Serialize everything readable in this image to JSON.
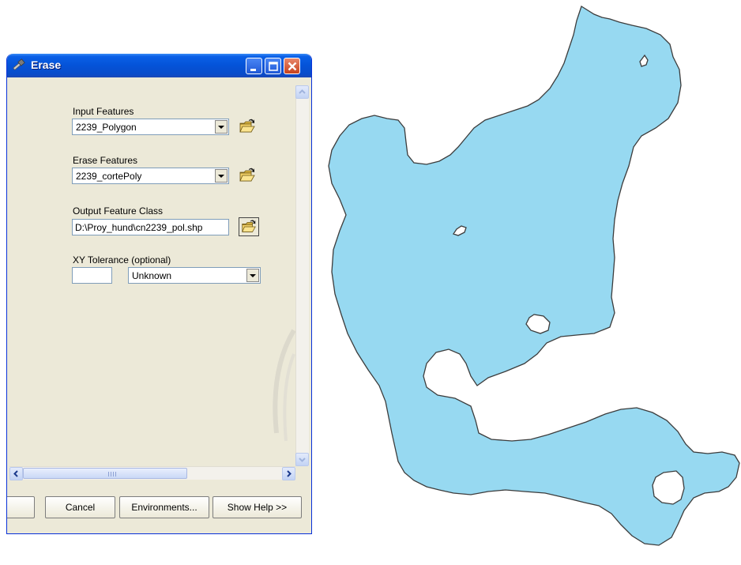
{
  "window": {
    "title": "Erase"
  },
  "form": {
    "input_features": {
      "label": "Input Features",
      "value": "2239_Polygon"
    },
    "erase_features": {
      "label": "Erase Features",
      "value": "2239_cortePoly"
    },
    "output_feature_class": {
      "label": "Output Feature Class",
      "value": "D:\\Proy_hund\\cn2239_pol.shp"
    },
    "xy_tolerance": {
      "label": "XY Tolerance (optional)",
      "value": "",
      "unit": "Unknown"
    }
  },
  "buttons": {
    "ok": "",
    "cancel": "Cancel",
    "environments": "Environments...",
    "show_help": "Show Help >>"
  },
  "icons": {
    "title": "hammer-icon",
    "browse": "open-folder-icon"
  },
  "colors": {
    "polygon_fill": "#97d9f1",
    "polygon_stroke": "#3c3c3c",
    "titlebar": "#0453d8"
  }
}
